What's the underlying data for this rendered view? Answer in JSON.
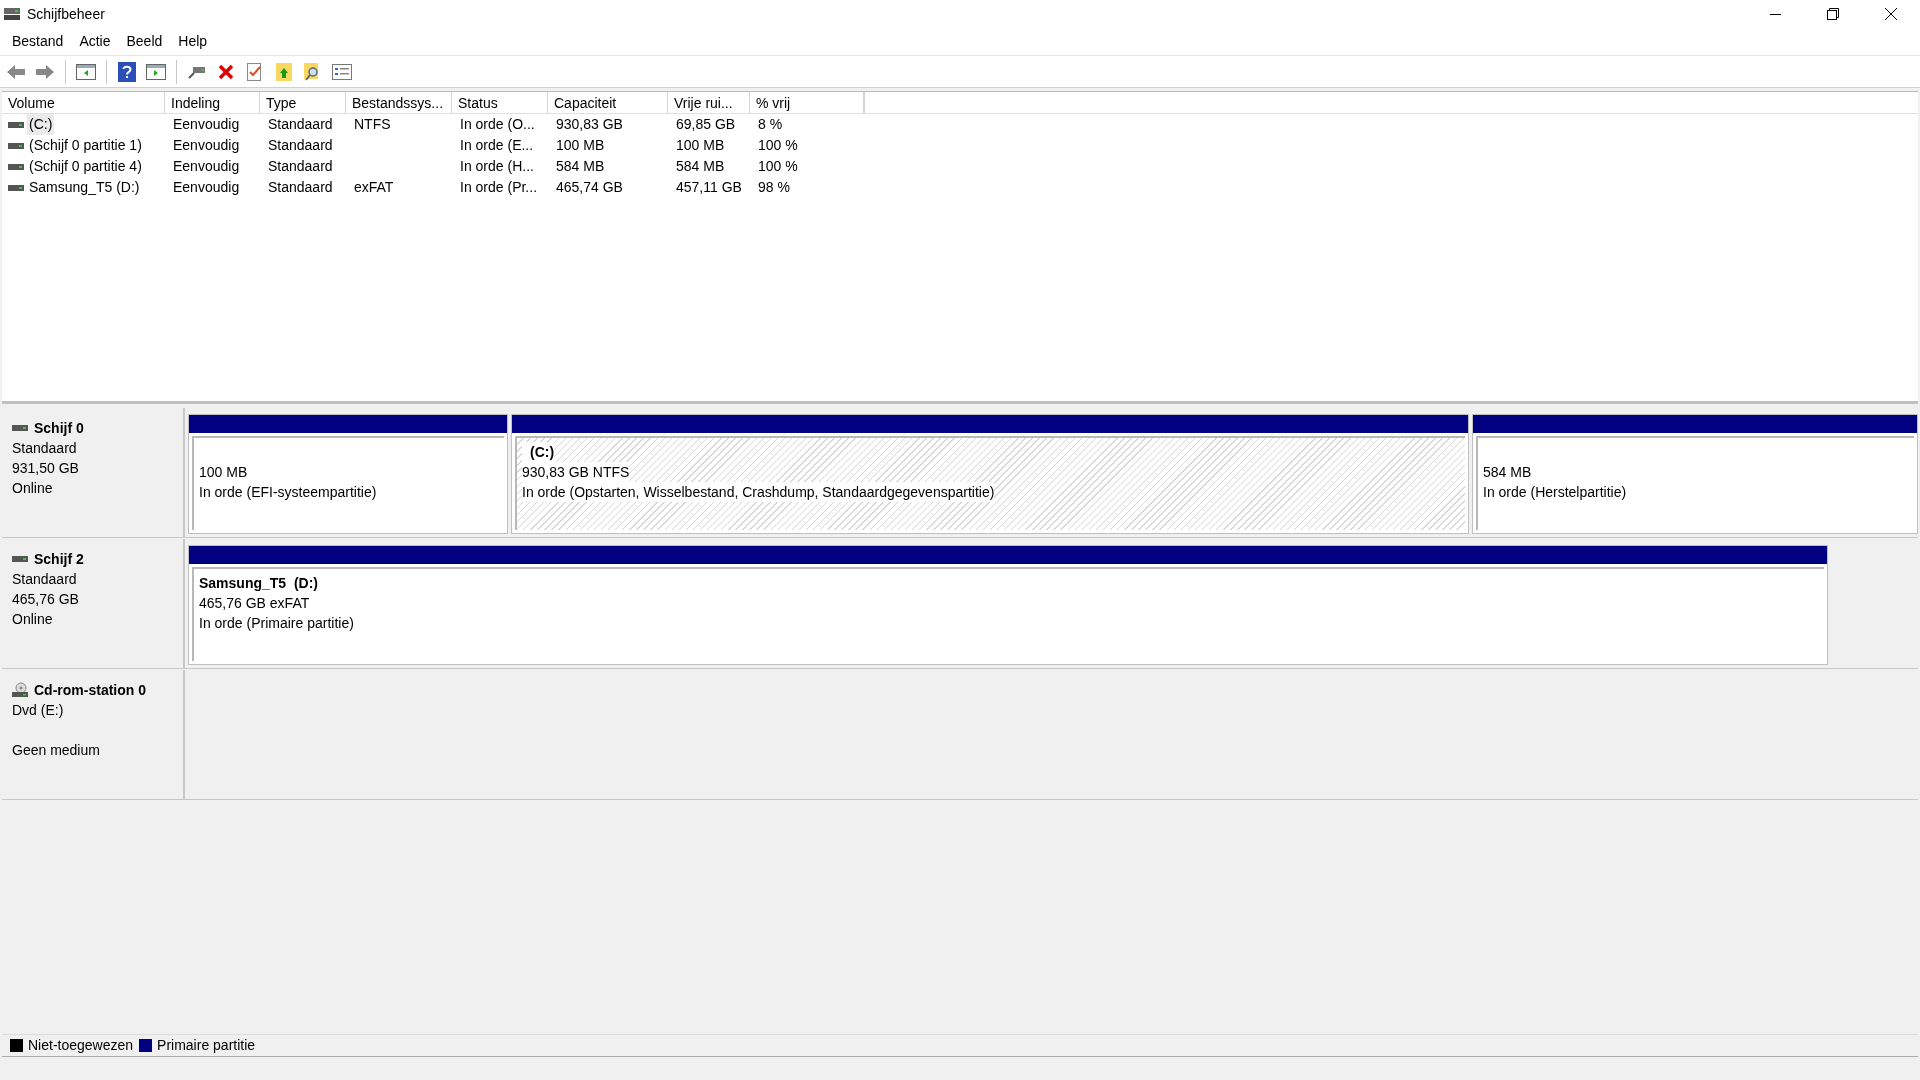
{
  "window": {
    "title": "Schijfbeheer"
  },
  "menu": [
    "Bestand",
    "Actie",
    "Beeld",
    "Help"
  ],
  "table": {
    "columns": [
      "Volume",
      "Indeling",
      "Type",
      "Bestandssys...",
      "Status",
      "Capaciteit",
      "Vrije rui...",
      "% vrij"
    ],
    "rows": [
      {
        "selected": true,
        "cells": [
          "(C:)",
          "Eenvoudig",
          "Standaard",
          "NTFS",
          "In orde (O...",
          "930,83 GB",
          "69,85 GB",
          "8 %"
        ]
      },
      {
        "selected": false,
        "cells": [
          "(Schijf 0 partitie 1)",
          "Eenvoudig",
          "Standaard",
          "",
          "In orde (E...",
          "100 MB",
          "100 MB",
          "100 %"
        ]
      },
      {
        "selected": false,
        "cells": [
          "(Schijf 0 partitie 4)",
          "Eenvoudig",
          "Standaard",
          "",
          "In orde (H...",
          "584 MB",
          "584 MB",
          "100 %"
        ]
      },
      {
        "selected": false,
        "cells": [
          "Samsung_T5 (D:)",
          "Eenvoudig",
          "Standaard",
          "exFAT",
          "In orde (Pr...",
          "465,74 GB",
          "457,11 GB",
          "98 %"
        ]
      }
    ]
  },
  "disks": [
    {
      "kind": "disk",
      "name": "Schijf 0",
      "lines": [
        "Standaard",
        "931,50 GB",
        "Online"
      ],
      "partitions": [
        {
          "selected": false,
          "size": "100 MB",
          "status": "In orde (EFI-systeempartitie)"
        },
        {
          "selected": true,
          "title": "(C:)",
          "size": "930,83 GB NTFS",
          "status": "In orde (Opstarten, Wisselbestand, Crashdump, Standaardgegevenspartitie)"
        },
        {
          "selected": false,
          "size": "584 MB",
          "status": "In orde (Herstelpartitie)"
        }
      ]
    },
    {
      "kind": "disk",
      "name": "Schijf 2",
      "lines": [
        "Standaard",
        "465,76 GB",
        "Online"
      ],
      "partitions": [
        {
          "selected": false,
          "title": "Samsung_T5  (D:)",
          "size": "465,76 GB exFAT",
          "status": "In orde (Primaire partitie)"
        }
      ]
    },
    {
      "kind": "cdrom",
      "name": "Cd-rom-station 0",
      "lines": [
        "Dvd (E:)"
      ],
      "note": "Geen medium"
    }
  ],
  "legend": [
    {
      "label": "Niet-toegewezen",
      "color": "#000000"
    },
    {
      "label": "Primaire partitie",
      "color": "#000080"
    }
  ]
}
